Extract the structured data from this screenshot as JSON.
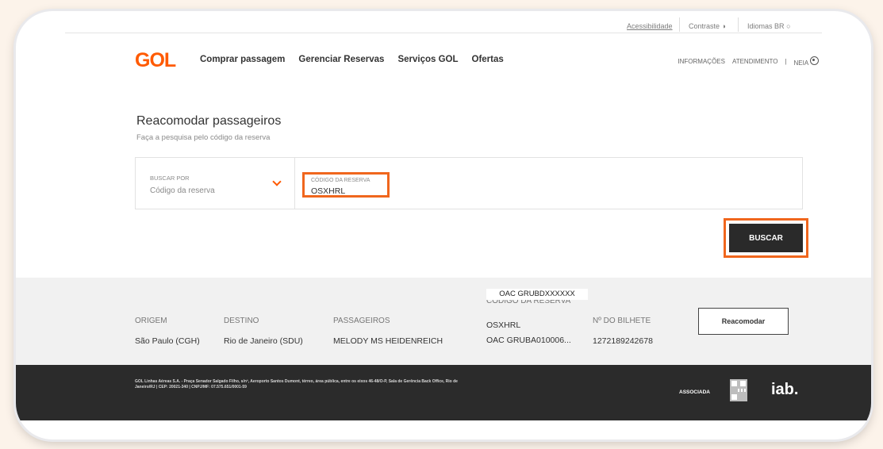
{
  "utility": {
    "accessibility": "Acessibilidade",
    "contrast": "Contraste",
    "contrast_icon": "half-circle-icon",
    "language": "Idiomas",
    "language_code": "BR"
  },
  "nav": {
    "logo": "GOL",
    "items": [
      "Comprar passagem",
      "Gerenciar Reservas",
      "Serviços GOL",
      "Ofertas"
    ],
    "info": "INFORMAÇÕES",
    "service": "ATENDIMENTO",
    "divider": "|",
    "user": "NEIA",
    "user_icon": "user-circle-icon"
  },
  "search": {
    "title": "Reacomodar passageiros",
    "subtitle": "Faça a pesquisa pelo código da reserva",
    "search_by_label": "BUSCAR POR",
    "search_by_value": "Código da reserva",
    "code_label": "CÓDIGO DA RESERVA",
    "code_value": "OSXHRL",
    "button": "BUSCAR"
  },
  "result": {
    "origin_label": "ORIGEM",
    "origin_value": "São Paulo (CGH)",
    "dest_label": "DESTINO",
    "dest_value": "Rio de Janeiro (SDU)",
    "pax_label": "PASSAGEIROS",
    "pax_value": "MELODY MS HEIDENREICH",
    "code_overlay": "OAC GRUBDXXXXXX",
    "code_label": "CÓDIGO DA RESERVA",
    "code_value": "OSXHRL",
    "code_value2": "OAC GRUBA010006...",
    "ticket_label": "Nº DO BILHETE",
    "ticket_value": "1272189242678",
    "button": "Reacomodar"
  },
  "footer": {
    "address": "GOL Linhas Aéreas S.A. - Praça Senador Salgado Filho, s/nº, Aeroporto Santos Dumont, térreo, área pública, entre os eixos 46-48/O-P, Sala de Gerência Back Office, Rio de Janeiro/RJ | CEP: 20021-340 | CNPJ/MF: 07.575.651/0001-59",
    "associada": "ASSOCIADA",
    "iab": "iab."
  },
  "colors": {
    "brand": "#ff5a00",
    "highlight": "#f0661d",
    "dark": "#2b2b2b"
  }
}
